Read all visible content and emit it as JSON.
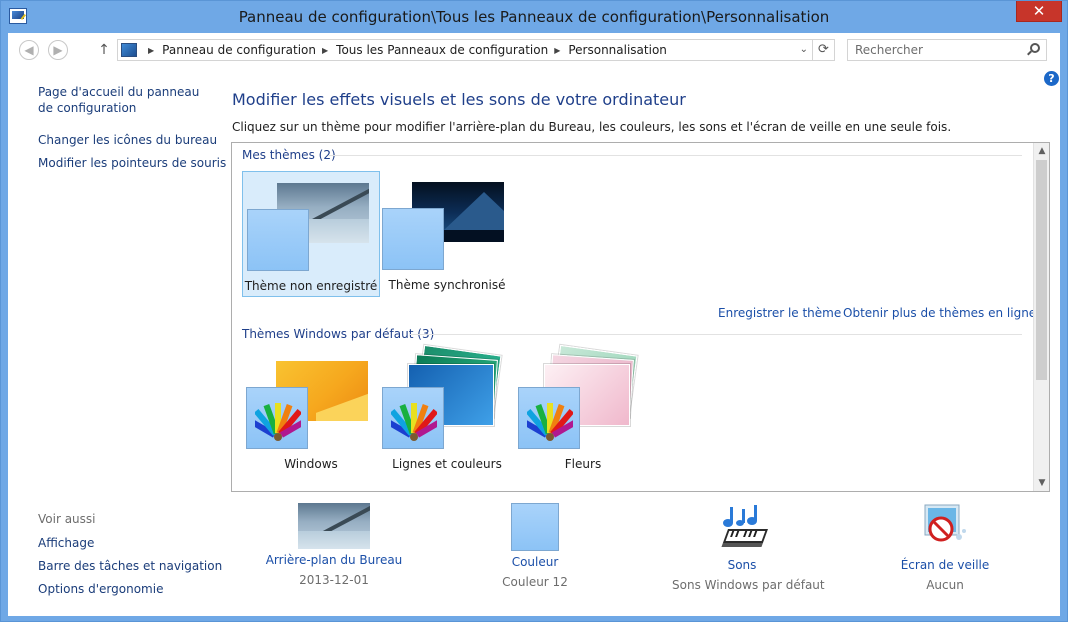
{
  "window": {
    "title": "Panneau de configuration\\Tous les Panneaux de configuration\\Personnalisation",
    "close_label": "✕"
  },
  "nav": {
    "back_icon": "◀",
    "forward_icon": "▶",
    "up_icon": "↑",
    "breadcrumb": [
      "Panneau de configuration",
      "Tous les Panneaux de configuration",
      "Personnalisation"
    ],
    "dropdown_icon": "⌄",
    "refresh_icon": "⟳",
    "search_placeholder": "Rechercher",
    "help_label": "?"
  },
  "left_pane": {
    "links": [
      "Page d'accueil du panneau de configuration",
      "Changer les icônes du bureau",
      "Modifier les pointeurs de souris"
    ],
    "see_also_title": "Voir aussi",
    "see_also": [
      "Affichage",
      "Barre des tâches et navigation",
      "Options d'ergonomie"
    ]
  },
  "main": {
    "heading": "Modifier les effets visuels et les sons de votre ordinateur",
    "subtext": "Cliquez sur un thème pour modifier l'arrière-plan du Bureau, les couleurs, les sons et l'écran de veille en une seule fois.",
    "my_themes": {
      "title": "Mes thèmes (2)",
      "items": [
        "Thème non enregistré",
        "Thème synchronisé"
      ],
      "selected": 0
    },
    "save_theme_link": "Enregistrer le thème",
    "more_themes_link": "Obtenir plus de thèmes en ligne",
    "default_themes": {
      "title": "Thèmes Windows par défaut (3)",
      "items": [
        "Windows",
        "Lignes et couleurs",
        "Fleurs"
      ]
    },
    "scroll_up_icon": "▲",
    "scroll_down_icon": "▼"
  },
  "bottom": {
    "items": [
      {
        "label": "Arrière-plan du Bureau",
        "sub": "2013-12-01",
        "icon": "wallpaper-thumbnail"
      },
      {
        "label": "Couleur",
        "sub": "Couleur 12",
        "icon": "color-swatch-icon"
      },
      {
        "label": "Sons",
        "sub": "Sons Windows par défaut",
        "icon": "music-keyboard-icon"
      },
      {
        "label": "Écran de veille",
        "sub": "Aucun",
        "icon": "screensaver-icon"
      }
    ]
  },
  "colors": {
    "frame": "#6fa8e6",
    "close_button": "#c7352a",
    "link": "#1b4fa8",
    "heading": "#1f3f8a",
    "selection": "#d9ecfb",
    "color_tile": "#a9d3fa"
  }
}
